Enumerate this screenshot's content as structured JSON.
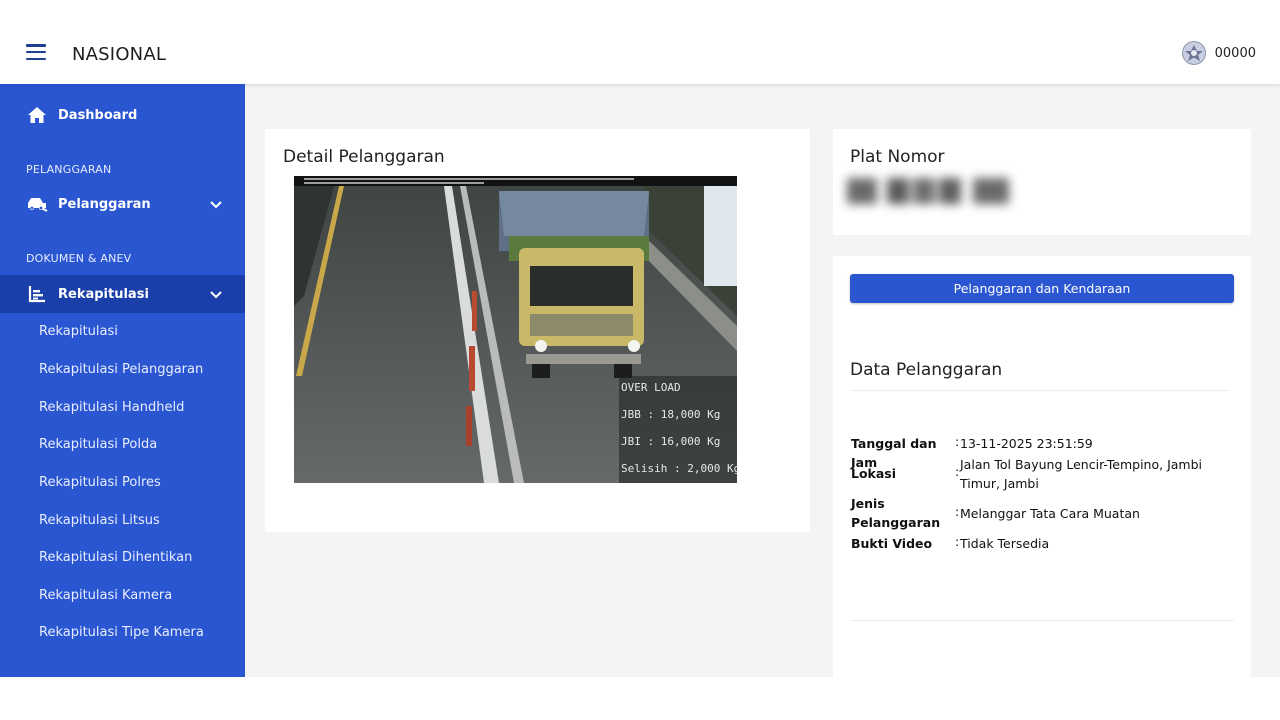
{
  "header": {
    "title": "NASIONAL",
    "user_name": "00000"
  },
  "sidebar": {
    "dashboard_label": "Dashboard",
    "section_pelanggaran": "PELANGGARAN",
    "pelanggaran_label": "Pelanggaran",
    "section_dokumen": "DOKUMEN & ANEV",
    "rekapitulasi_label": "Rekapitulasi",
    "sub_items": [
      "Rekapitulasi",
      "Rekapitulasi Pelanggaran",
      "Rekapitulasi Handheld",
      "Rekapitulasi Polda",
      "Rekapitulasi Polres",
      "Rekapitulasi Litsus",
      "Rekapitulasi Dihentikan",
      "Rekapitulasi Kamera",
      "Rekapitulasi Tipe Kamera"
    ]
  },
  "detail": {
    "title": "Detail Pelanggaran",
    "photo_overlay": {
      "over_load": "OVER LOAD",
      "jbb": "JBB : 18,000 Kg",
      "jbi": "JBI : 16,000 Kg",
      "selisih": "Selisih : 2,000 Kg"
    }
  },
  "plate": {
    "title": "Plat Nomor"
  },
  "data_pelanggaran": {
    "button_label": "Pelanggaran dan Kendaraan",
    "title": "Data Pelanggaran",
    "rows": [
      {
        "label": "Tanggal dan Jam",
        "value": "13-11-2025 23:51:59"
      },
      {
        "label": "Lokasi",
        "value": "Jalan Tol Bayung Lencir-Tempino, Jambi Timur, Jambi"
      },
      {
        "label": "Jenis Pelanggaran",
        "value": "Melanggar Tata Cara Muatan"
      },
      {
        "label": "Bukti Video",
        "value": "Tidak Tersedia"
      }
    ]
  },
  "colors": {
    "sidebar": "#2a56d2",
    "sidebar_active": "#1a3fa8",
    "primary_button": "#2a56d2",
    "content_bg": "#f4f4f6"
  }
}
